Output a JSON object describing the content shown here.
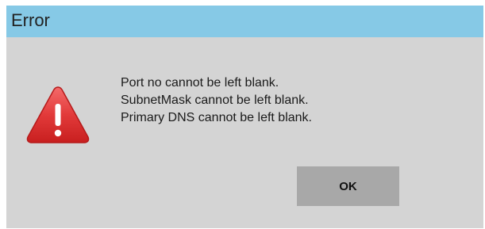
{
  "dialog": {
    "title": "Error",
    "icon": "warning-triangle-icon",
    "messages": [
      "Port no cannot be left blank.",
      "SubnetMask cannot be left blank.",
      "Primary DNS cannot be left blank."
    ],
    "ok_label": "OK"
  },
  "colors": {
    "title_bar": "#86c9e6",
    "dialog_background": "#d4d4d4",
    "button_background": "#a8a8a8",
    "warning_red": "#e23a3a"
  }
}
